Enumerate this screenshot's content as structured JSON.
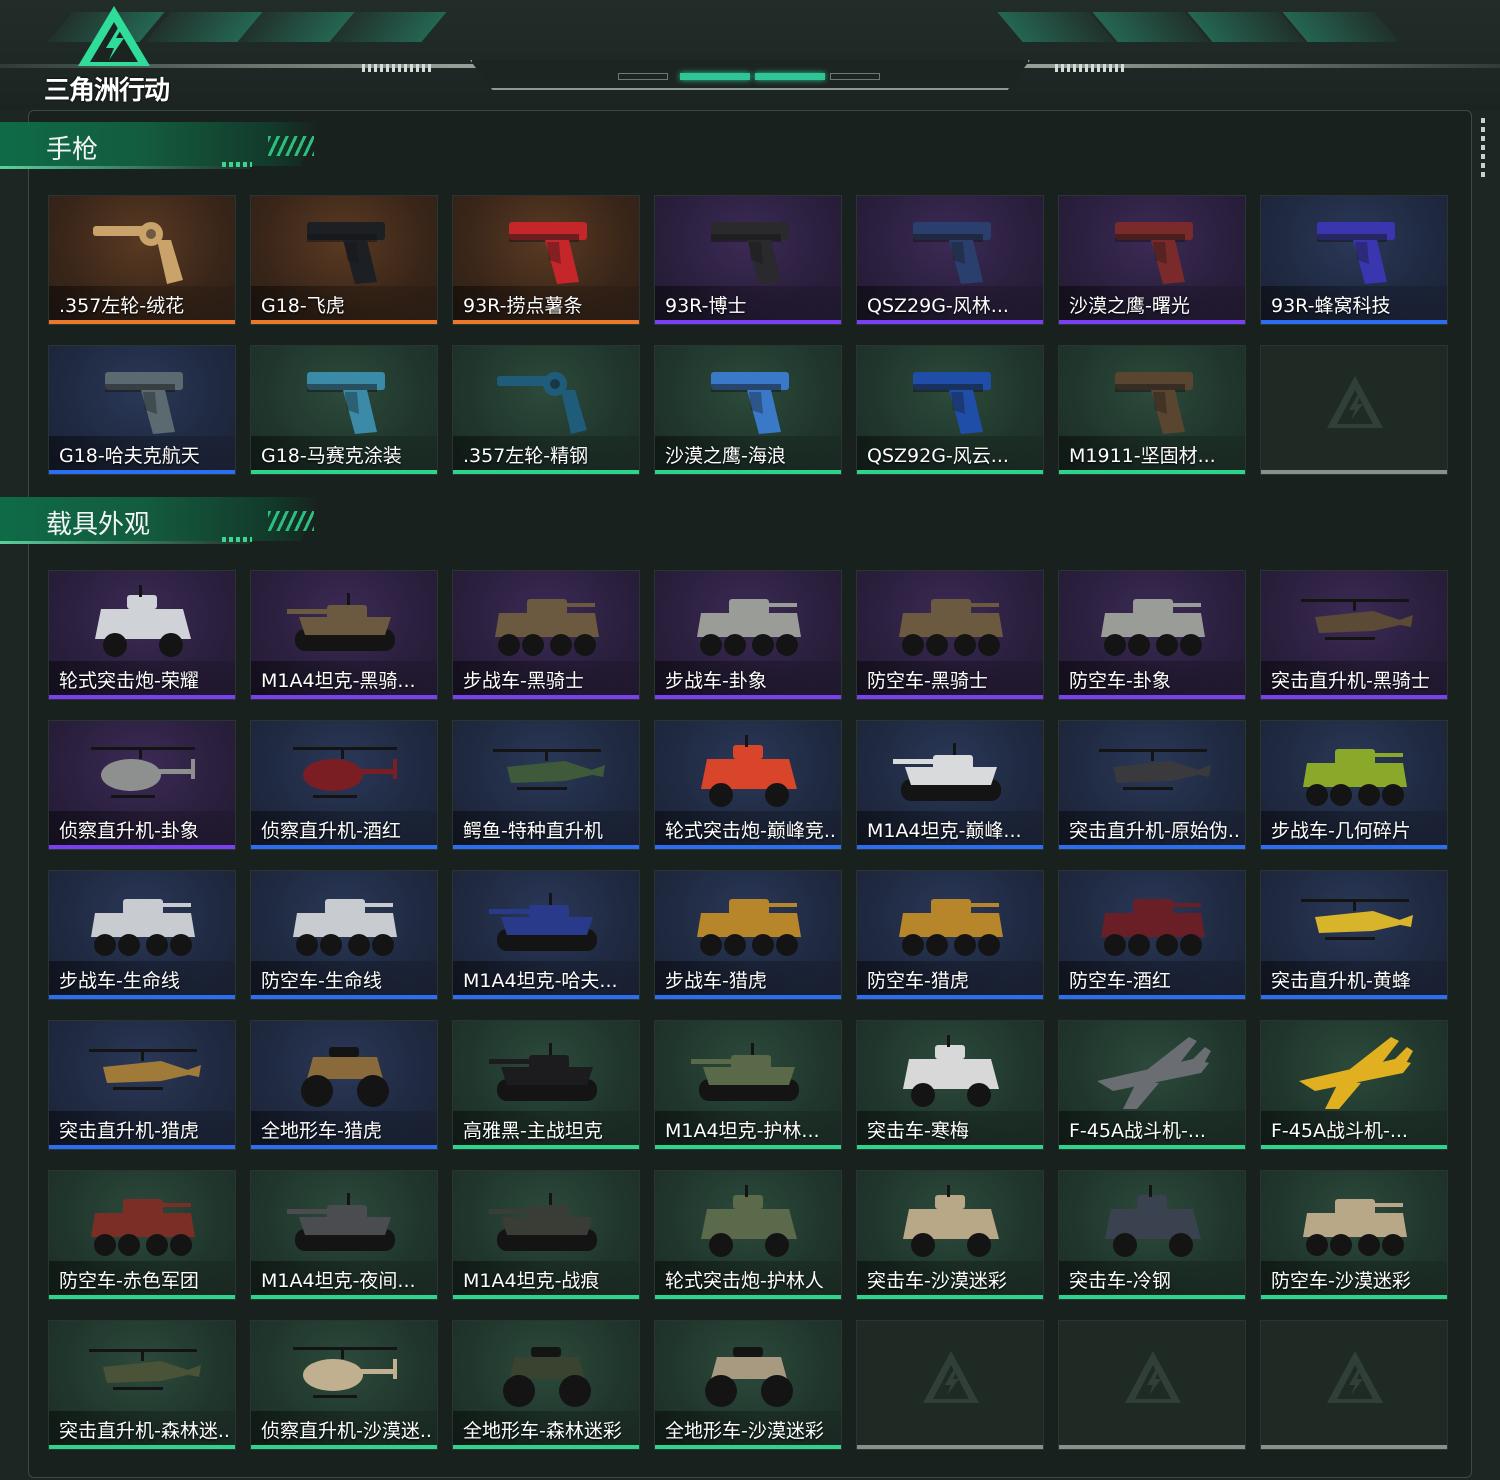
{
  "header": {
    "logo_text": "三角洲行动"
  },
  "colors": {
    "accent": "#2fc596",
    "rarity_orange": "#e9782a",
    "rarity_purple": "#7a3ff0",
    "rarity_blue": "#2c6ef0",
    "rarity_green": "#2fd48c",
    "rarity_empty": "#8a918d"
  },
  "sections": [
    {
      "title": "手枪",
      "items": [
        {
          "label": ".357左轮-绒花",
          "rarity": "orange",
          "icon": "revolver-icon",
          "tint": "#c9a36a"
        },
        {
          "label": "G18-飞虎",
          "rarity": "orange",
          "icon": "pistol-icon",
          "tint": "#1c1f24"
        },
        {
          "label": "93R-捞点薯条",
          "rarity": "orange",
          "icon": "pistol-icon",
          "tint": "#c4262a"
        },
        {
          "label": "93R-博士",
          "rarity": "purple",
          "icon": "pistol-icon",
          "tint": "#2a2a2e"
        },
        {
          "label": "QSZ29G-风林...",
          "rarity": "purple",
          "icon": "pistol-icon",
          "tint": "#2a3f6e"
        },
        {
          "label": "沙漠之鹰-曙光",
          "rarity": "purple",
          "icon": "pistol-icon",
          "tint": "#7a2a2a"
        },
        {
          "label": "93R-蜂窝科技",
          "rarity": "blue",
          "icon": "pistol-icon",
          "tint": "#3a36b0"
        },
        {
          "label": "G18-哈夫克航天",
          "rarity": "blue",
          "icon": "pistol-icon",
          "tint": "#5a6a70"
        },
        {
          "label": "G18-马赛克涂装",
          "rarity": "green",
          "icon": "pistol-icon",
          "tint": "#3a8aa8"
        },
        {
          "label": ".357左轮-精钢",
          "rarity": "green",
          "icon": "revolver-icon",
          "tint": "#1f5c7a"
        },
        {
          "label": "沙漠之鹰-海浪",
          "rarity": "green",
          "icon": "pistol-icon",
          "tint": "#3a78c8"
        },
        {
          "label": "QSZ92G-风云...",
          "rarity": "green",
          "icon": "pistol-icon",
          "tint": "#1f4ea8"
        },
        {
          "label": "M1911-坚固材...",
          "rarity": "green",
          "icon": "pistol-icon",
          "tint": "#5a4630"
        },
        {
          "label": "",
          "rarity": "empty",
          "icon": "",
          "tint": ""
        }
      ]
    },
    {
      "title": "载具外观",
      "items": [
        {
          "label": "轮式突击炮-荣耀",
          "rarity": "purple",
          "icon": "armored-car-icon",
          "tint": "#cfd3d8"
        },
        {
          "label": "M1A4坦克-黑骑...",
          "rarity": "purple",
          "icon": "tank-icon",
          "tint": "#6b5a40"
        },
        {
          "label": "步战车-黑骑士",
          "rarity": "purple",
          "icon": "apc-icon",
          "tint": "#6b5a40"
        },
        {
          "label": "步战车-卦象",
          "rarity": "purple",
          "icon": "apc-icon",
          "tint": "#9a9c98"
        },
        {
          "label": "防空车-黑骑士",
          "rarity": "purple",
          "icon": "apc-icon",
          "tint": "#6b5a40"
        },
        {
          "label": "防空车-卦象",
          "rarity": "purple",
          "icon": "apc-icon",
          "tint": "#9a9c98"
        },
        {
          "label": "突击直升机-黑骑士",
          "rarity": "purple",
          "icon": "attack-helicopter-icon",
          "tint": "#5a4a36"
        },
        {
          "label": "侦察直升机-卦象",
          "rarity": "purple",
          "icon": "scout-helicopter-icon",
          "tint": "#8e9090"
        },
        {
          "label": "侦察直升机-酒红",
          "rarity": "blue",
          "icon": "scout-helicopter-icon",
          "tint": "#7a1e24"
        },
        {
          "label": "鳄鱼-特种直升机",
          "rarity": "blue",
          "icon": "attack-helicopter-icon",
          "tint": "#3f5a3a"
        },
        {
          "label": "轮式突击炮-巅峰竞...",
          "rarity": "blue",
          "icon": "armored-car-icon",
          "tint": "#d8452a"
        },
        {
          "label": "M1A4坦克-巅峰...",
          "rarity": "blue",
          "icon": "tank-icon",
          "tint": "#d8dadc"
        },
        {
          "label": "突击直升机-原始伪...",
          "rarity": "blue",
          "icon": "attack-helicopter-icon",
          "tint": "#3a3a3e"
        },
        {
          "label": "步战车-几何碎片",
          "rarity": "blue",
          "icon": "apc-icon",
          "tint": "#8aa82a"
        },
        {
          "label": "步战车-生命线",
          "rarity": "blue",
          "icon": "apc-icon",
          "tint": "#c8ccd0"
        },
        {
          "label": "防空车-生命线",
          "rarity": "blue",
          "icon": "apc-icon",
          "tint": "#c8ccd0"
        },
        {
          "label": "M1A4坦克-哈夫...",
          "rarity": "blue",
          "icon": "tank-icon",
          "tint": "#2a3a8a"
        },
        {
          "label": "步战车-猎虎",
          "rarity": "blue",
          "icon": "apc-icon",
          "tint": "#b8862a"
        },
        {
          "label": "防空车-猎虎",
          "rarity": "blue",
          "icon": "apc-icon",
          "tint": "#b8862a"
        },
        {
          "label": "防空车-酒红",
          "rarity": "blue",
          "icon": "apc-icon",
          "tint": "#6a1e26"
        },
        {
          "label": "突击直升机-黄蜂",
          "rarity": "blue",
          "icon": "attack-helicopter-icon",
          "tint": "#d8b42a"
        },
        {
          "label": "突击直升机-猎虎",
          "rarity": "blue",
          "icon": "attack-helicopter-icon",
          "tint": "#a07a38"
        },
        {
          "label": "全地形车-猎虎",
          "rarity": "blue",
          "icon": "atv-icon",
          "tint": "#8a6a3a"
        },
        {
          "label": "高雅黑-主战坦克",
          "rarity": "green",
          "icon": "tank-icon",
          "tint": "#1c1c1e"
        },
        {
          "label": "M1A4坦克-护林...",
          "rarity": "green",
          "icon": "tank-icon",
          "tint": "#5a6a48"
        },
        {
          "label": "突击车-寒梅",
          "rarity": "green",
          "icon": "armored-car-icon",
          "tint": "#d8d8d8"
        },
        {
          "label": "F-45A战斗机-...",
          "rarity": "green",
          "icon": "jet-icon",
          "tint": "#6a6e72"
        },
        {
          "label": "F-45A战斗机-...",
          "rarity": "green",
          "icon": "jet-icon",
          "tint": "#e0b020"
        },
        {
          "label": "防空车-赤色军团",
          "rarity": "green",
          "icon": "apc-icon",
          "tint": "#7a2e26"
        },
        {
          "label": "M1A4坦克-夜间...",
          "rarity": "green",
          "icon": "tank-icon",
          "tint": "#4a4c50"
        },
        {
          "label": "M1A4坦克-战痕",
          "rarity": "green",
          "icon": "tank-icon",
          "tint": "#3a3c36"
        },
        {
          "label": "轮式突击炮-护林人",
          "rarity": "green",
          "icon": "armored-car-icon",
          "tint": "#5a6a4a"
        },
        {
          "label": "突击车-沙漠迷彩",
          "rarity": "green",
          "icon": "armored-car-icon",
          "tint": "#b8a888"
        },
        {
          "label": "突击车-冷钢",
          "rarity": "green",
          "icon": "armored-car-icon",
          "tint": "#3a4250"
        },
        {
          "label": "防空车-沙漠迷彩",
          "rarity": "green",
          "icon": "apc-icon",
          "tint": "#b8a888"
        },
        {
          "label": "突击直升机-森林迷...",
          "rarity": "green",
          "icon": "attack-helicopter-icon",
          "tint": "#4a5238"
        },
        {
          "label": "侦察直升机-沙漠迷...",
          "rarity": "green",
          "icon": "scout-helicopter-icon",
          "tint": "#c0b090"
        },
        {
          "label": "全地形车-森林迷彩",
          "rarity": "green",
          "icon": "atv-icon",
          "tint": "#3a4230"
        },
        {
          "label": "全地形车-沙漠迷彩",
          "rarity": "green",
          "icon": "atv-icon",
          "tint": "#a89a80"
        },
        {
          "label": "",
          "rarity": "empty",
          "icon": "",
          "tint": ""
        },
        {
          "label": "",
          "rarity": "empty",
          "icon": "",
          "tint": ""
        },
        {
          "label": "",
          "rarity": "empty",
          "icon": "",
          "tint": ""
        }
      ]
    }
  ]
}
